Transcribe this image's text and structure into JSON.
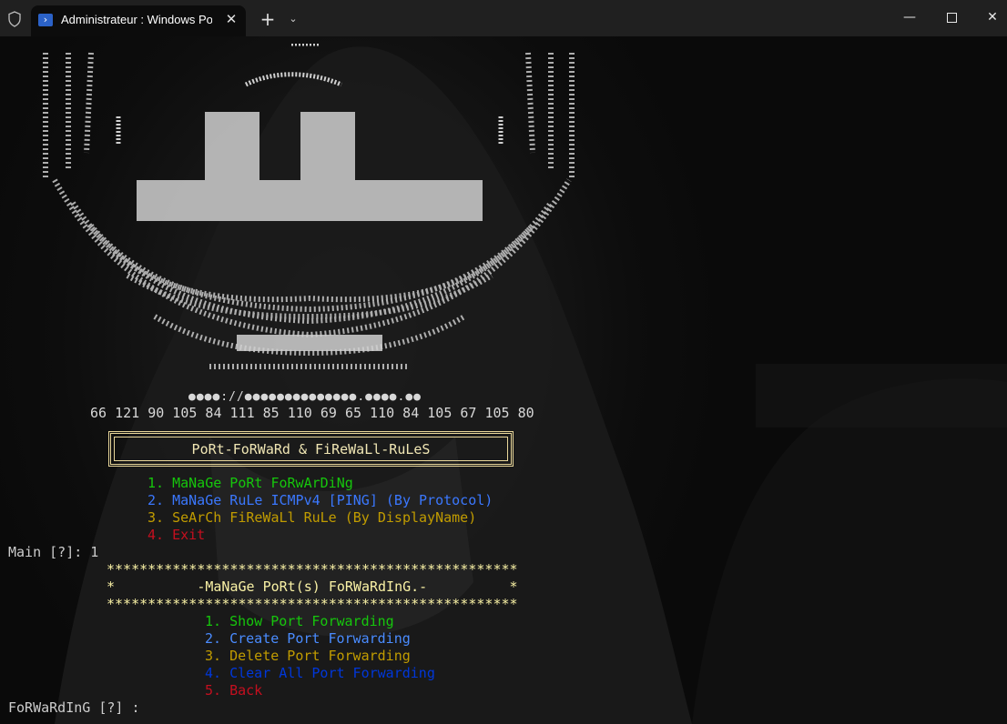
{
  "window": {
    "tab_title": "Administrateur : Windows Pov",
    "tab_close": "✕",
    "new_tab": "+",
    "dropdown": "⌄",
    "minimize": "—",
    "close": "✕"
  },
  "icons": {
    "shield": "shield-icon",
    "powershell": "powershell-icon"
  },
  "console": {
    "url": "●●●●://●●●●●●●●●●●●●●.●●●●.●●",
    "numbers": "66 121 90 105 84 111 85 110 69 65 110 84 105 67 105 80",
    "banner": "PoRt-FoRWaRd & FiReWaLl-RuLeS",
    "main_menu": [
      {
        "num": "1.",
        "label": "MaNaGe PoRt FoRwArDiNg"
      },
      {
        "num": "2.",
        "label": "MaNaGe RuLe ICMPv4 [PING] (By Protocol)"
      },
      {
        "num": "3.",
        "label": "SeArCh FiReWaLl RuLe (By DisplayName)"
      },
      {
        "num": "4.",
        "label": "Exit"
      }
    ],
    "main_prompt": "Main [?]: 1",
    "stars_line": "**************************************************",
    "sub_title_line": "*          -MaNaGe PoRt(s) FoRWaRdInG.-          *",
    "sub_menu": [
      {
        "num": "1.",
        "label": "Show Port Forwarding"
      },
      {
        "num": "2.",
        "label": "Create Port Forwarding"
      },
      {
        "num": "3.",
        "label": "Delete Port Forwarding"
      },
      {
        "num": "4.",
        "label": "Clear All Port Forwarding"
      },
      {
        "num": "5.",
        "label": "Back"
      }
    ],
    "sub_prompt": "FoRWaRdInG [?] :"
  },
  "colors": {
    "green": "#16c60c",
    "blue": "#3b78ff",
    "gold": "#c19c00",
    "red": "#c50f1f",
    "banner": "#f0e6b4",
    "stars": "#f9f1a5"
  }
}
